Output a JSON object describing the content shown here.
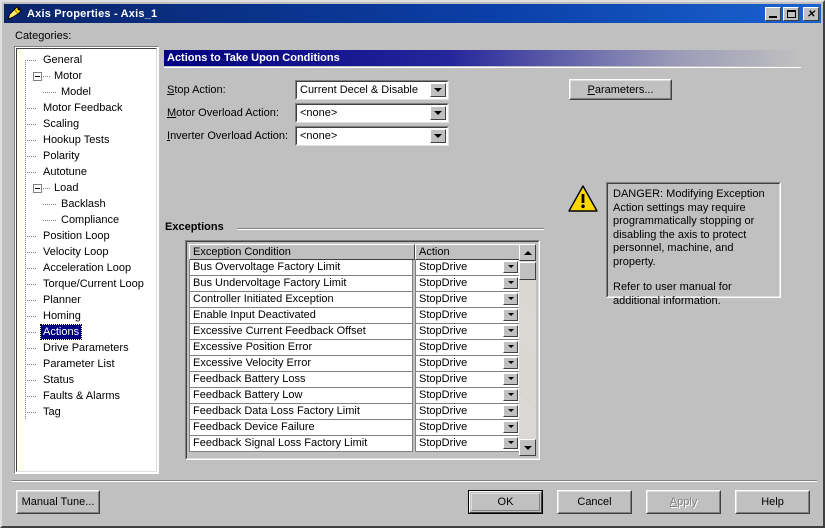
{
  "window": {
    "title": "Axis Properties - Axis_1",
    "icon": "axis-properties-icon",
    "minimize_label": "_",
    "maximize_label": "□",
    "close_label": "×"
  },
  "sidebar": {
    "label": "Categories:",
    "selected": "Actions",
    "items": [
      {
        "label": "General",
        "indent": 1,
        "expander": "none"
      },
      {
        "label": "Motor",
        "indent": 1,
        "expander": "minus"
      },
      {
        "label": "Model",
        "indent": 2,
        "expander": "none"
      },
      {
        "label": "Motor Feedback",
        "indent": 1,
        "expander": "none"
      },
      {
        "label": "Scaling",
        "indent": 1,
        "expander": "none"
      },
      {
        "label": "Hookup Tests",
        "indent": 1,
        "expander": "none"
      },
      {
        "label": "Polarity",
        "indent": 1,
        "expander": "none"
      },
      {
        "label": "Autotune",
        "indent": 1,
        "expander": "none"
      },
      {
        "label": "Load",
        "indent": 1,
        "expander": "minus"
      },
      {
        "label": "Backlash",
        "indent": 2,
        "expander": "none"
      },
      {
        "label": "Compliance",
        "indent": 2,
        "expander": "none"
      },
      {
        "label": "Position Loop",
        "indent": 1,
        "expander": "none"
      },
      {
        "label": "Velocity Loop",
        "indent": 1,
        "expander": "none"
      },
      {
        "label": "Acceleration Loop",
        "indent": 1,
        "expander": "none"
      },
      {
        "label": "Torque/Current Loop",
        "indent": 1,
        "expander": "none"
      },
      {
        "label": "Planner",
        "indent": 1,
        "expander": "none"
      },
      {
        "label": "Homing",
        "indent": 1,
        "expander": "none"
      },
      {
        "label": "Actions",
        "indent": 1,
        "expander": "none"
      },
      {
        "label": "Drive Parameters",
        "indent": 1,
        "expander": "none"
      },
      {
        "label": "Parameter List",
        "indent": 1,
        "expander": "none"
      },
      {
        "label": "Status",
        "indent": 1,
        "expander": "none"
      },
      {
        "label": "Faults & Alarms",
        "indent": 1,
        "expander": "none"
      },
      {
        "label": "Tag",
        "indent": 1,
        "expander": "none"
      }
    ]
  },
  "main": {
    "group_title": "Actions to Take Upon Conditions",
    "fields": [
      {
        "label": "Stop Action:",
        "accel": "S",
        "value": "Current Decel & Disable"
      },
      {
        "label": "Motor Overload Action:",
        "accel": "M",
        "value": "<none>"
      },
      {
        "label": "Inverter Overload Action:",
        "accel": "I",
        "value": "<none>"
      }
    ],
    "parameters_button": "Parameters...",
    "parameters_accel": "P",
    "warning": {
      "icon": "warning-triangle-icon",
      "line1": "DANGER: Modifying Exception Action settings may require programmatically stopping or disabling the axis to protect personnel, machine, and property.",
      "line2": "Refer to user manual for additional information.",
      "color": "#ffd700"
    },
    "exceptions": {
      "title": "Exceptions",
      "columns": [
        "Exception Condition",
        "Action"
      ],
      "rows": [
        {
          "condition": "Bus Overvoltage Factory Limit",
          "action": "StopDrive"
        },
        {
          "condition": "Bus Undervoltage Factory Limit",
          "action": "StopDrive"
        },
        {
          "condition": "Controller Initiated Exception",
          "action": "StopDrive"
        },
        {
          "condition": "Enable Input Deactivated",
          "action": "StopDrive"
        },
        {
          "condition": "Excessive Current Feedback Offset",
          "action": "StopDrive"
        },
        {
          "condition": "Excessive Position Error",
          "action": "StopDrive"
        },
        {
          "condition": "Excessive Velocity Error",
          "action": "StopDrive"
        },
        {
          "condition": "Feedback Battery Loss",
          "action": "StopDrive"
        },
        {
          "condition": "Feedback Battery Low",
          "action": "StopDrive"
        },
        {
          "condition": "Feedback Data Loss Factory Limit",
          "action": "StopDrive"
        },
        {
          "condition": "Feedback Device Failure",
          "action": "StopDrive"
        },
        {
          "condition": "Feedback Signal Loss Factory Limit",
          "action": "StopDrive"
        }
      ]
    }
  },
  "footer": {
    "manual_tune": "Manual Tune...",
    "ok": "OK",
    "cancel": "Cancel",
    "apply": "Apply",
    "apply_accel": "A",
    "apply_disabled": true,
    "help": "Help"
  },
  "colors": {
    "face": "#c0c0c0",
    "title_start": "#0a246a",
    "selection": "#000080",
    "warning": "#ffd700"
  }
}
